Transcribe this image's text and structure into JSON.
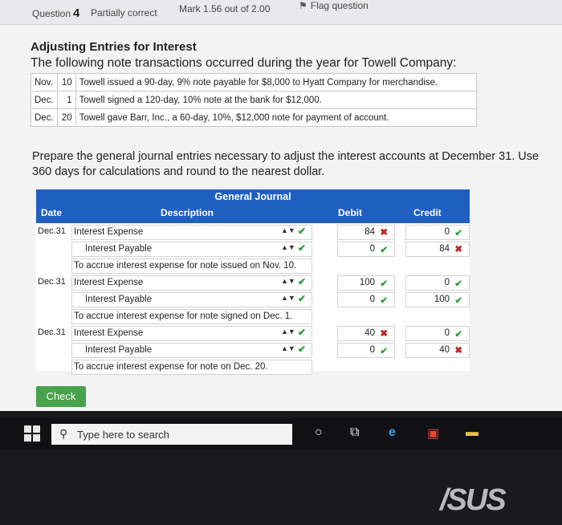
{
  "header": {
    "question_prefix": "Question",
    "question_number": "4",
    "state": "Partially correct",
    "mark": "Mark 1.56 out of 2.00",
    "flag": "Flag question"
  },
  "problem": {
    "title": "Adjusting Entries for Interest",
    "subtitle": "The following note transactions occurred during the year for Towell Company:",
    "notes": [
      {
        "month": "Nov.",
        "day": "10",
        "text": "Towell issued a 90-day, 9% note payable for $8,000 to Hyatt Company for merchandise."
      },
      {
        "month": "Dec.",
        "day": "1",
        "text": "Towell signed a 120-day, 10% note at the bank for $12,000."
      },
      {
        "month": "Dec.",
        "day": "20",
        "text": "Towell gave Barr, Inc., a 60-day, 10%, $12,000 note for payment of account."
      }
    ],
    "prompt": "Prepare the general journal entries necessary to adjust the interest accounts at December 31. Use 360 days for calculations and round to the nearest dollar."
  },
  "journal": {
    "title": "General Journal",
    "headers": {
      "date": "Date",
      "description": "Description",
      "debit": "Debit",
      "credit": "Credit"
    },
    "entries": [
      {
        "date": "Dec.31",
        "debit_account": "Interest Expense",
        "credit_account": "Interest Payable",
        "debit_row": {
          "debit": "84",
          "debit_ok": false,
          "credit": "0",
          "credit_ok": true
        },
        "credit_row": {
          "debit": "0",
          "debit_ok": true,
          "credit": "84",
          "credit_ok": false
        },
        "memo": "To accrue interest expense for note issued on Nov. 10."
      },
      {
        "date": "Dec.31",
        "debit_account": "Interest Expense",
        "credit_account": "Interest Payable",
        "debit_row": {
          "debit": "100",
          "debit_ok": true,
          "credit": "0",
          "credit_ok": true
        },
        "credit_row": {
          "debit": "0",
          "debit_ok": true,
          "credit": "100",
          "credit_ok": true
        },
        "memo": "To accrue interest expense for note signed on Dec. 1."
      },
      {
        "date": "Dec.31",
        "debit_account": "Interest Expense",
        "credit_account": "Interest Payable",
        "debit_row": {
          "debit": "40",
          "debit_ok": false,
          "credit": "0",
          "credit_ok": true
        },
        "credit_row": {
          "debit": "0",
          "debit_ok": true,
          "credit": "40",
          "credit_ok": false
        },
        "memo": "To accrue interest expense for note on Dec. 20."
      }
    ]
  },
  "check_button": "Check",
  "taskbar": {
    "search_placeholder": "Type here to search"
  },
  "brand": "/SUS",
  "colors": {
    "header_blue": "#1f5fbf",
    "check_green": "#46a24b",
    "correct": "#2a9d3a",
    "incorrect": "#c02424"
  }
}
